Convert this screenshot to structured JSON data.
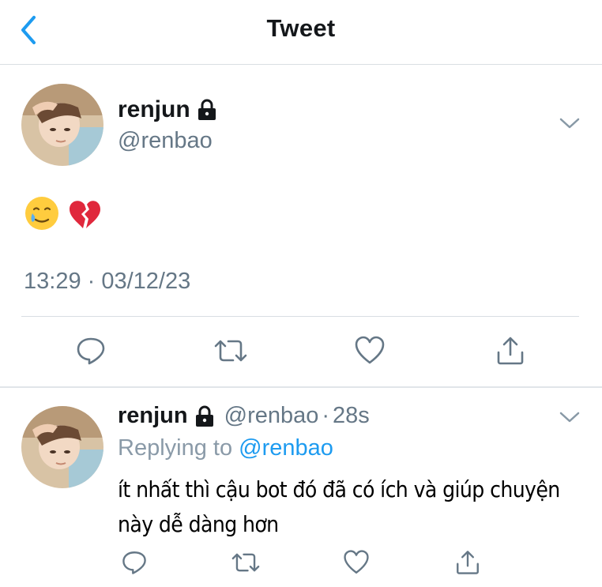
{
  "header": {
    "title": "Tweet",
    "back_icon": "chevron-left-icon"
  },
  "tweet": {
    "name": "renjun",
    "handle": "@renbao",
    "emojis": [
      "🥲",
      "💔"
    ],
    "timestamp": "13:29 · 03/12/23",
    "actions": [
      "reply-icon",
      "retweet-icon",
      "like-icon",
      "share-icon"
    ]
  },
  "reply": {
    "name": "renjun",
    "handle": "@renbao",
    "separator": "·",
    "time": "28s",
    "replying_prefix": "Replying to",
    "replying_to": "@renbao",
    "text_line1": "ít nhất thì cậu bot đó đã có ích và giúp chuyện",
    "text_line2": "này dễ dàng hơn",
    "actions": [
      "reply-icon",
      "retweet-icon",
      "like-icon",
      "share-icon"
    ]
  },
  "colors": {
    "accent": "#1d9bf0",
    "secondary_text": "#657786",
    "divider": "#d9dee3"
  }
}
